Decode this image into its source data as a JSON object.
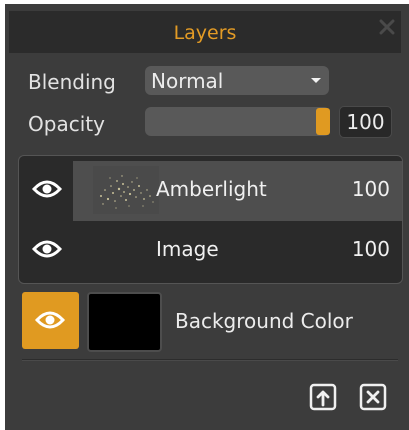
{
  "panel": {
    "title": "Layers",
    "close_icon": "close-icon"
  },
  "blending": {
    "label": "Blending",
    "selected": "Normal"
  },
  "opacity": {
    "label": "Opacity",
    "value": "100",
    "slider_fraction": 1.0
  },
  "layers": [
    {
      "name": "Amberlight",
      "opacity": "100",
      "visible": true,
      "selected": true,
      "thumbnail": "speckle-thumbnail"
    },
    {
      "name": "Image",
      "opacity": "100",
      "visible": true,
      "selected": false
    }
  ],
  "background": {
    "label": "Background Color",
    "color": "#000000",
    "visibility_toggle_color": "#e09a21"
  },
  "footer": {
    "buttons": [
      "export-icon",
      "delete-icon"
    ]
  },
  "colors": {
    "accent": "#e09a21",
    "title": "#e39b25",
    "panel_bg": "#3c3c3c"
  }
}
